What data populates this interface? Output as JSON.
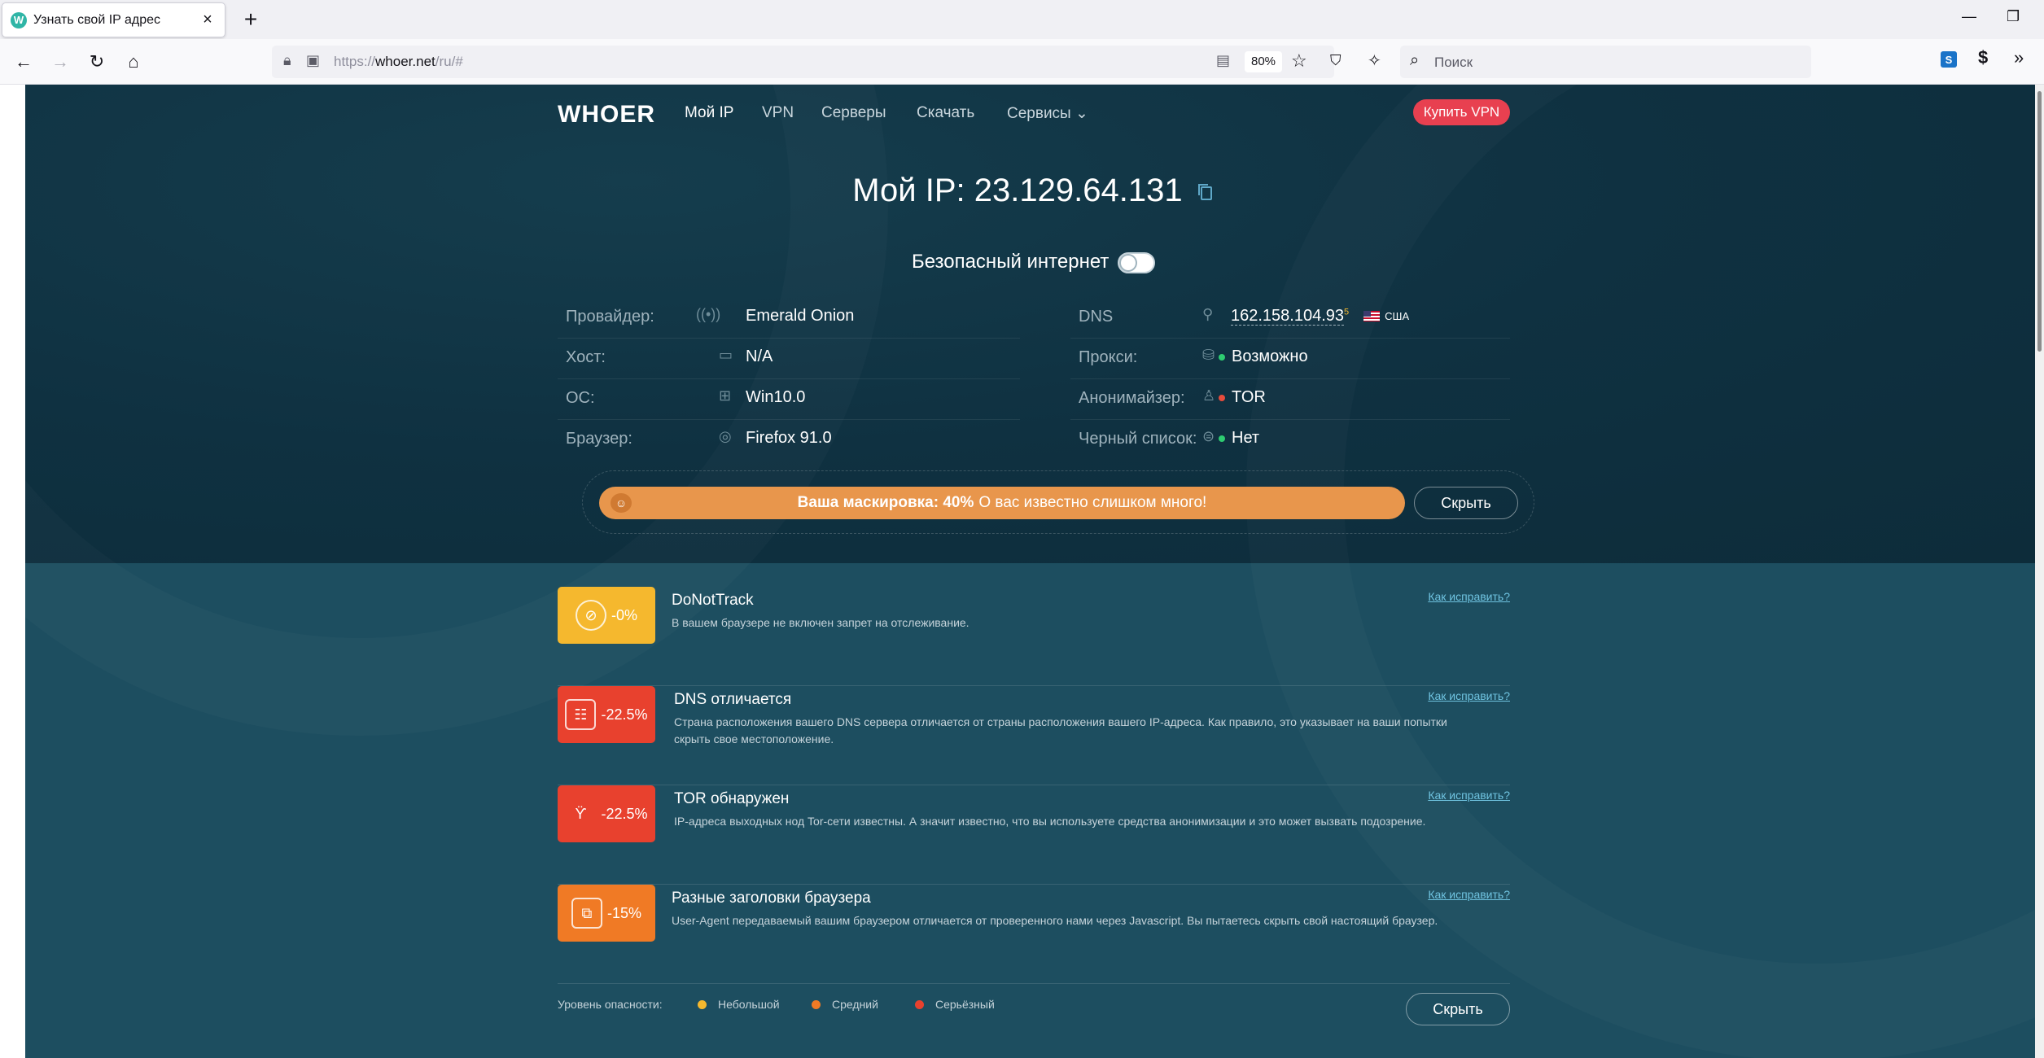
{
  "browser": {
    "tab_title": "Узнать свой IP адрес",
    "url_prefix": "https://",
    "url_host": "whoer.net",
    "url_path": "/ru/#",
    "zoom": "80%",
    "search_placeholder": "Поиск"
  },
  "site": {
    "logo": "WHOER",
    "menu": [
      "Мой IP",
      "VPN",
      "Серверы",
      "Скачать",
      "Сервисы ⌄"
    ],
    "buy_button": "Купить VPN",
    "ip_title": "Мой IP: 23.129.64.131",
    "safe_internet": "Безопасный интернет"
  },
  "info": {
    "provider": {
      "label": "Провайдер:",
      "value": "Emerald Onion"
    },
    "host": {
      "label": "Хост:",
      "value": "N/A"
    },
    "os": {
      "label": "ОС:",
      "value": "Win10.0"
    },
    "browser": {
      "label": "Браузер:",
      "value": "Firefox 91.0"
    },
    "dns": {
      "label": "DNS",
      "value": "162.158.104.93",
      "sup": "5",
      "country": "США"
    },
    "proxy": {
      "label": "Прокси:",
      "value": "Возможно",
      "status_color": "#2ecc71"
    },
    "anonymizer": {
      "label": "Анонимайзер:",
      "value": "TOR",
      "status_color": "#e74c3c"
    },
    "blacklist": {
      "label": "Черный список:",
      "value": "Нет",
      "status_color": "#2ecc71"
    }
  },
  "mask": {
    "bold": "Ваша маскировка: 40%",
    "text": "О вас известно слишком много!",
    "hide": "Скрыть"
  },
  "issues": [
    {
      "badge": "-0%",
      "color": "#f5b82e",
      "title": "DoNotTrack",
      "desc": "В вашем браузере не включен запрет на отслеживание.",
      "fix": "Как исправить?"
    },
    {
      "badge": "-22.5%",
      "color": "#e8412e",
      "title": "DNS отличается",
      "desc": "Страна расположения вашего DNS сервера отличается от страны расположения вашего IP-адреса. Как правило, это указывает на ваши попытки скрыть свое местоположение.",
      "fix": "Как исправить?"
    },
    {
      "badge": "-22.5%",
      "color": "#e8412e",
      "title": "TOR обнаружен",
      "desc": "IP-адреса выходных нод Tor-сети известны. А значит известно, что вы используете средства анонимизации и это может вызвать подозрение.",
      "fix": "Как исправить?"
    },
    {
      "badge": "-15%",
      "color": "#f07a25",
      "title": "Разные заголовки браузера",
      "desc": "User-Agent передаваемый вашим браузером отличается от проверенного нами через Javascript. Вы пытаетесь скрыть свой настоящий браузер.",
      "fix": "Как исправить?"
    }
  ],
  "legend": {
    "label": "Уровень опасности:",
    "low": "Небольшой",
    "medium": "Средний",
    "high": "Серьёзный",
    "colors": {
      "low": "#f5b82e",
      "medium": "#f07a25",
      "high": "#e8412e"
    },
    "hide": "Скрыть"
  }
}
